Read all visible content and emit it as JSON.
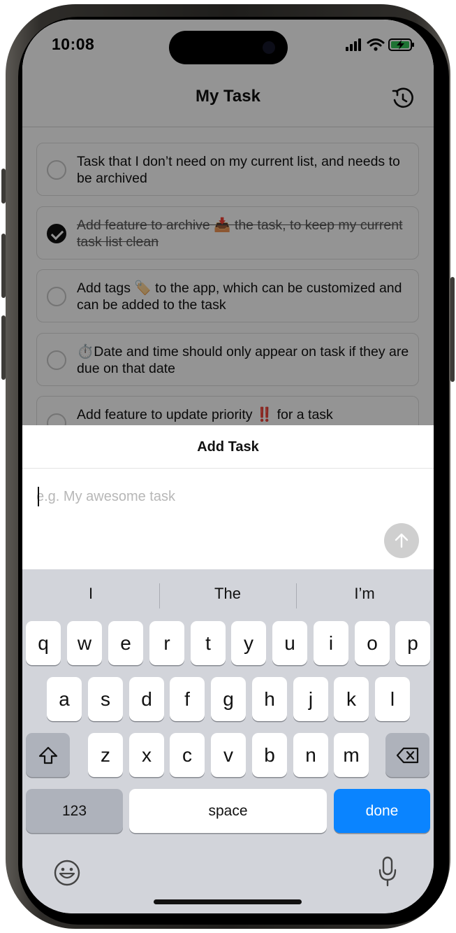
{
  "status_bar": {
    "time": "10:08"
  },
  "nav": {
    "title": "My Task",
    "history_icon": "history-icon"
  },
  "tasks": [
    {
      "text": "Task that I don’t need on my current list, and needs to be archived",
      "done": false
    },
    {
      "text": "Add feature to archive 📥 the task, to keep my current task list clean",
      "done": true
    },
    {
      "text": "Add tags 🏷️ to the app, which can be customized and can be added to the task",
      "done": false
    },
    {
      "text": "⏱️Date and time should only appear on task if they are due on that date",
      "done": false
    },
    {
      "text": "Add feature to update priority ‼️ for a task",
      "done": false
    }
  ],
  "sheet": {
    "title": "Add Task",
    "input_placeholder": "e.g. My awesome task",
    "input_value": "",
    "send_icon": "arrow-up-icon"
  },
  "keyboard": {
    "suggestions": [
      "I",
      "The",
      "I’m"
    ],
    "row1": [
      "q",
      "w",
      "e",
      "r",
      "t",
      "y",
      "u",
      "i",
      "o",
      "p"
    ],
    "row2": [
      "a",
      "s",
      "d",
      "f",
      "g",
      "h",
      "j",
      "k",
      "l"
    ],
    "row3": [
      "z",
      "x",
      "c",
      "v",
      "b",
      "n",
      "m"
    ],
    "numbers_label": "123",
    "space_label": "space",
    "done_label": "done",
    "accent_color": "#0a84ff"
  }
}
